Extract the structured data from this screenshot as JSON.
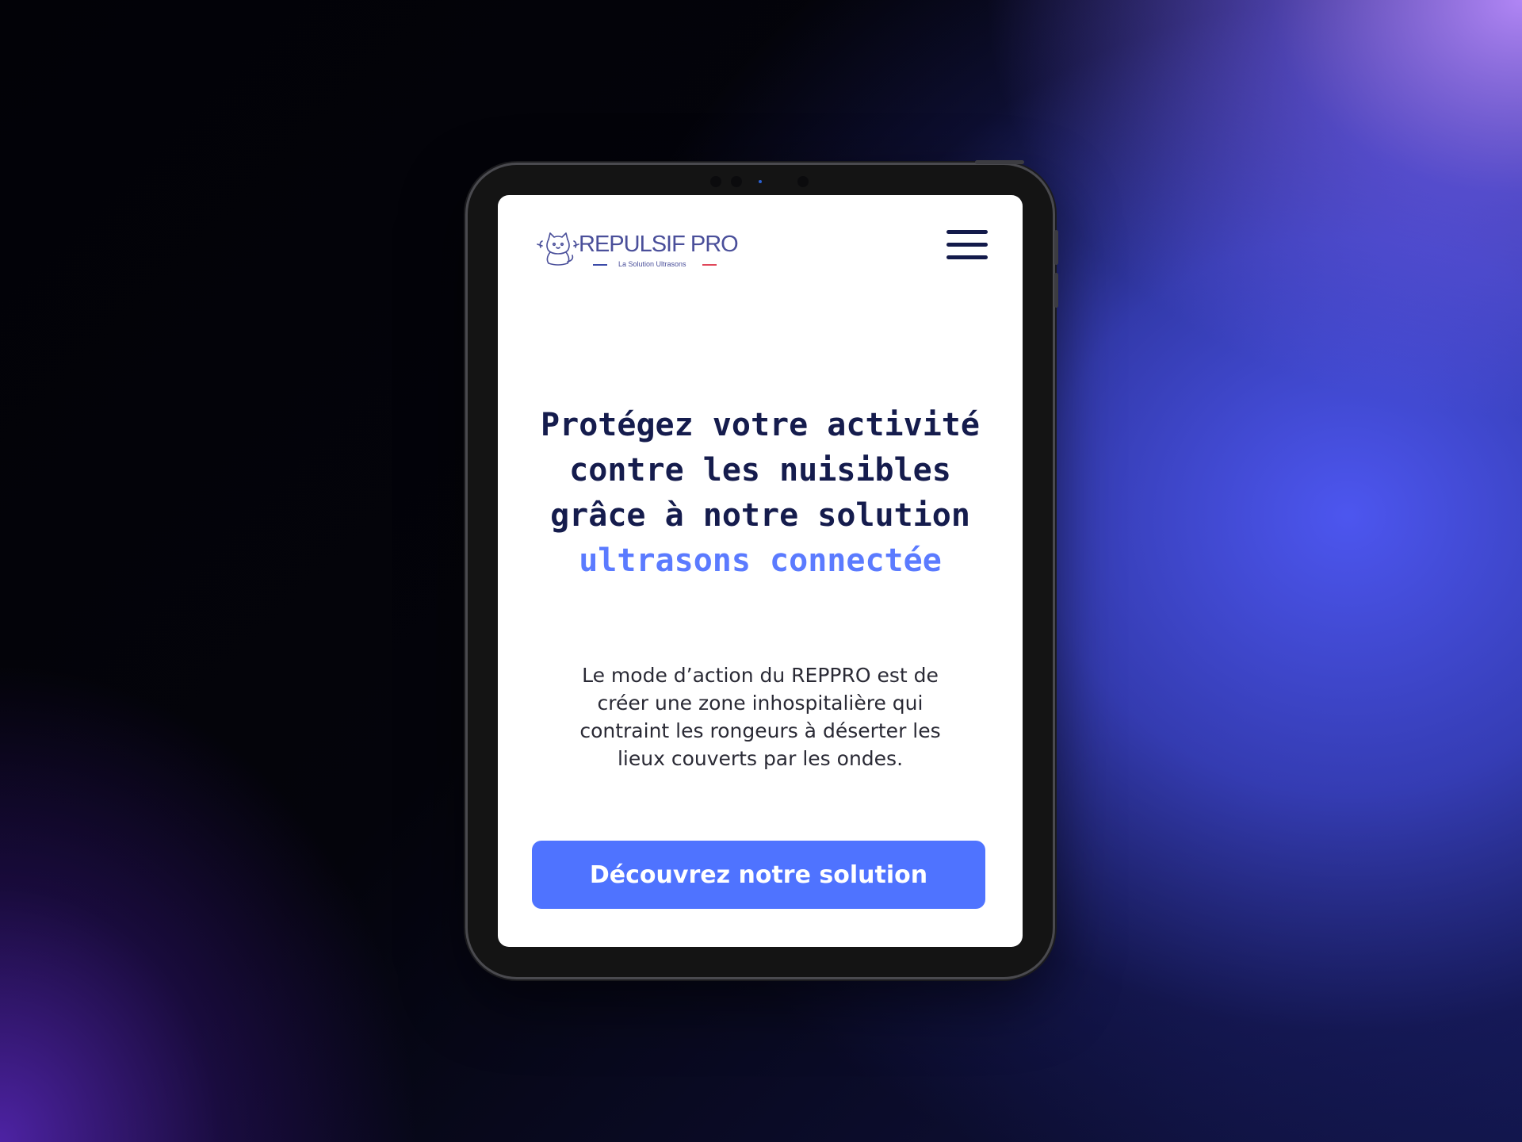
{
  "header": {
    "logo_name": "REPULSIF PRO",
    "logo_tagline": "La Solution Ultrasons",
    "logo_icon": "cat-mascot-icon",
    "menu_icon": "hamburger-menu-icon"
  },
  "hero": {
    "headline": "Protégez votre activité contre les nuisibles grâce à notre solution",
    "headline_accent": "ultrasons connectée",
    "description": "Le mode d’action du REPPRO est de créer une zone inhospitalière qui contraint les rongeurs à déserter les lieux couverts par les ondes.",
    "cta_label": "Découvrez notre solution"
  },
  "colors": {
    "accent": "#5b7bff",
    "button": "#4f73ff",
    "headline": "#151c4d"
  }
}
